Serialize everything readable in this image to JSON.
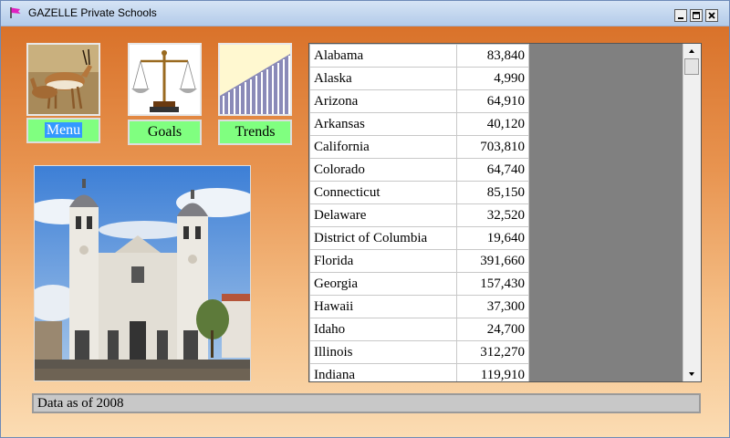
{
  "window": {
    "title": "GAZELLE Private Schools",
    "colors": {
      "accent_green": "#80ff80",
      "selection_blue": "#3399ff",
      "orange": "#d9722a"
    },
    "icons": [
      "flag-icon",
      "minimize-icon",
      "maximize-icon",
      "close-icon"
    ]
  },
  "nav": {
    "menu_label": "Menu",
    "goals_label": "Goals",
    "trends_label": "Trends"
  },
  "table": {
    "rows": [
      {
        "state": "Alabama",
        "value": "83,840"
      },
      {
        "state": "Alaska",
        "value": "4,990"
      },
      {
        "state": "Arizona",
        "value": "64,910"
      },
      {
        "state": "Arkansas",
        "value": "40,120"
      },
      {
        "state": "California",
        "value": "703,810"
      },
      {
        "state": "Colorado",
        "value": "64,740"
      },
      {
        "state": "Connecticut",
        "value": "85,150"
      },
      {
        "state": "Delaware",
        "value": "32,520"
      },
      {
        "state": "District of Columbia",
        "value": "19,640"
      },
      {
        "state": "Florida",
        "value": "391,660"
      },
      {
        "state": "Georgia",
        "value": "157,430"
      },
      {
        "state": "Hawaii",
        "value": "37,300"
      },
      {
        "state": "Idaho",
        "value": "24,700"
      },
      {
        "state": "Illinois",
        "value": "312,270"
      },
      {
        "state": "Indiana",
        "value": "119,910"
      }
    ]
  },
  "status": {
    "text": "Data as of 2008"
  }
}
